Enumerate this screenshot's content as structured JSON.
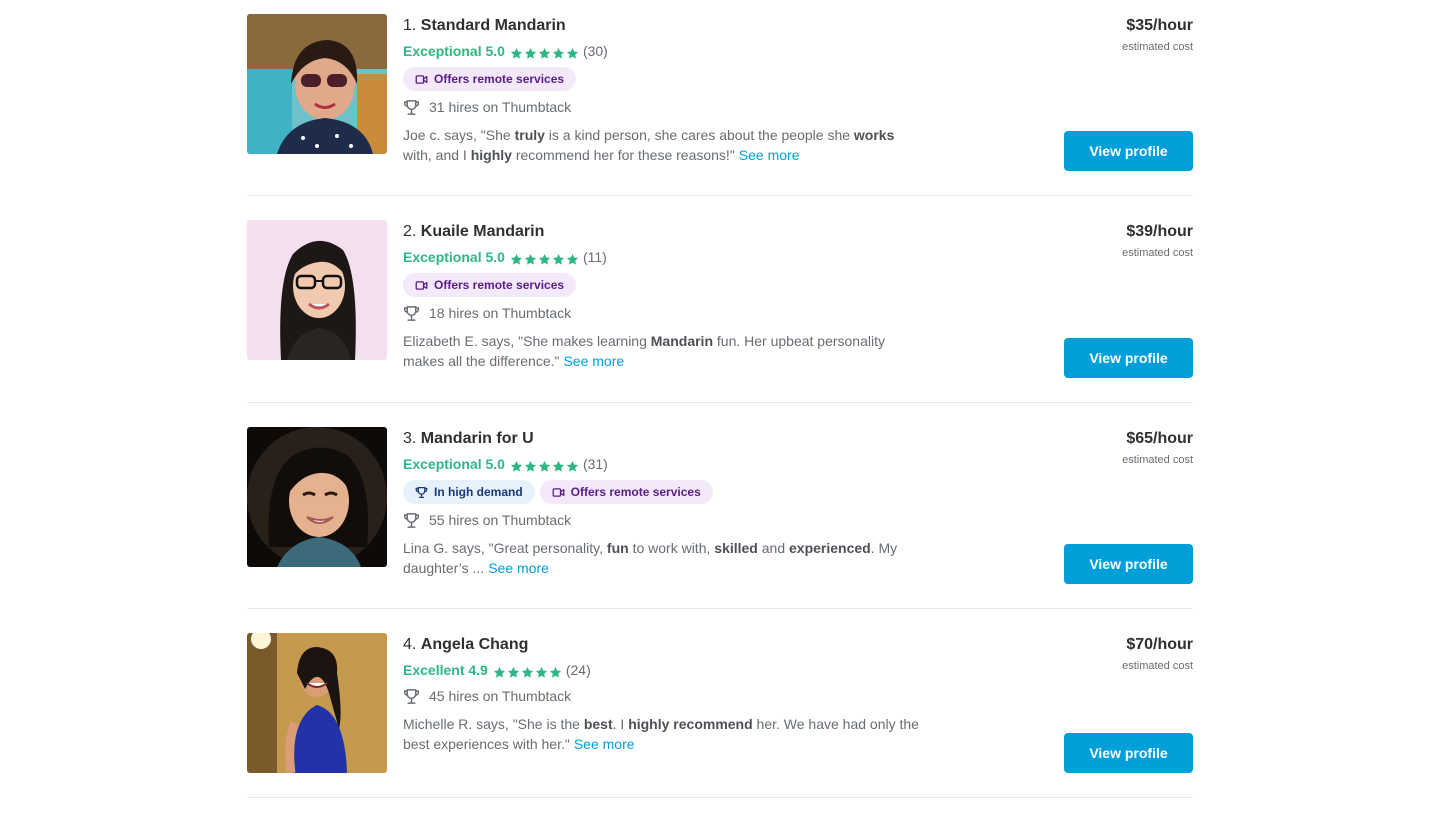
{
  "colors": {
    "accent": "#009fd9",
    "rating_green": "#2db783",
    "remote_badge_bg": "#f4e8fb",
    "demand_badge_bg": "#e6f1fc"
  },
  "pros": [
    {
      "number": "1.",
      "name": "Standard Mandarin",
      "rating_label": "Exceptional 5.0",
      "stars": 5,
      "reviews_count": "(30)",
      "badges": [
        "Offers remote services"
      ],
      "hires": "31 hires on Thumbtack",
      "review_parts": [
        {
          "t": "Joe c. says, \"She ",
          "b": false
        },
        {
          "t": "truly",
          "b": true
        },
        {
          "t": " is a kind person, she cares about the people she ",
          "b": false
        },
        {
          "t": "works",
          "b": true
        },
        {
          "t": " with, and I ",
          "b": false
        },
        {
          "t": "highly",
          "b": true
        },
        {
          "t": " recommend her for these reasons!\"",
          "b": false
        }
      ],
      "see_more": "See more",
      "price": "$35/hour",
      "price_note": "estimated cost",
      "button": "View profile"
    },
    {
      "number": "2.",
      "name": "Kuaile Mandarin",
      "rating_label": "Exceptional 5.0",
      "stars": 5,
      "reviews_count": "(11)",
      "badges": [
        "Offers remote services"
      ],
      "hires": "18 hires on Thumbtack",
      "review_parts": [
        {
          "t": "Elizabeth E. says, \"She makes learning ",
          "b": false
        },
        {
          "t": "Mandarin",
          "b": true
        },
        {
          "t": " fun. Her upbeat personality makes all the difference.\"",
          "b": false
        }
      ],
      "see_more": "See more",
      "price": "$39/hour",
      "price_note": "estimated cost",
      "button": "View profile"
    },
    {
      "number": "3.",
      "name": "Mandarin for U",
      "rating_label": "Exceptional 5.0",
      "stars": 5,
      "reviews_count": "(31)",
      "badges": [
        "In high demand",
        "Offers remote services"
      ],
      "hires": "55 hires on Thumbtack",
      "review_parts": [
        {
          "t": "Lina G. says, \"Great personality, ",
          "b": false
        },
        {
          "t": "fun",
          "b": true
        },
        {
          "t": " to work with, ",
          "b": false
        },
        {
          "t": "skilled",
          "b": true
        },
        {
          "t": " and ",
          "b": false
        },
        {
          "t": "experienced",
          "b": true
        },
        {
          "t": ". My daughter’s ...",
          "b": false
        }
      ],
      "see_more": "See more",
      "price": "$65/hour",
      "price_note": "estimated cost",
      "button": "View profile"
    },
    {
      "number": "4.",
      "name": "Angela Chang",
      "rating_label": "Excellent 4.9",
      "stars": 5,
      "reviews_count": "(24)",
      "badges": [],
      "hires": "45 hires on Thumbtack",
      "review_parts": [
        {
          "t": "Michelle R. says, \"She is the ",
          "b": false
        },
        {
          "t": "best",
          "b": true
        },
        {
          "t": ". I ",
          "b": false
        },
        {
          "t": "highly recommend",
          "b": true
        },
        {
          "t": " her. We have had only the best experiences with her.\"",
          "b": false
        }
      ],
      "see_more": "See more",
      "price": "$70/hour",
      "price_note": "estimated cost",
      "button": "View profile"
    }
  ]
}
